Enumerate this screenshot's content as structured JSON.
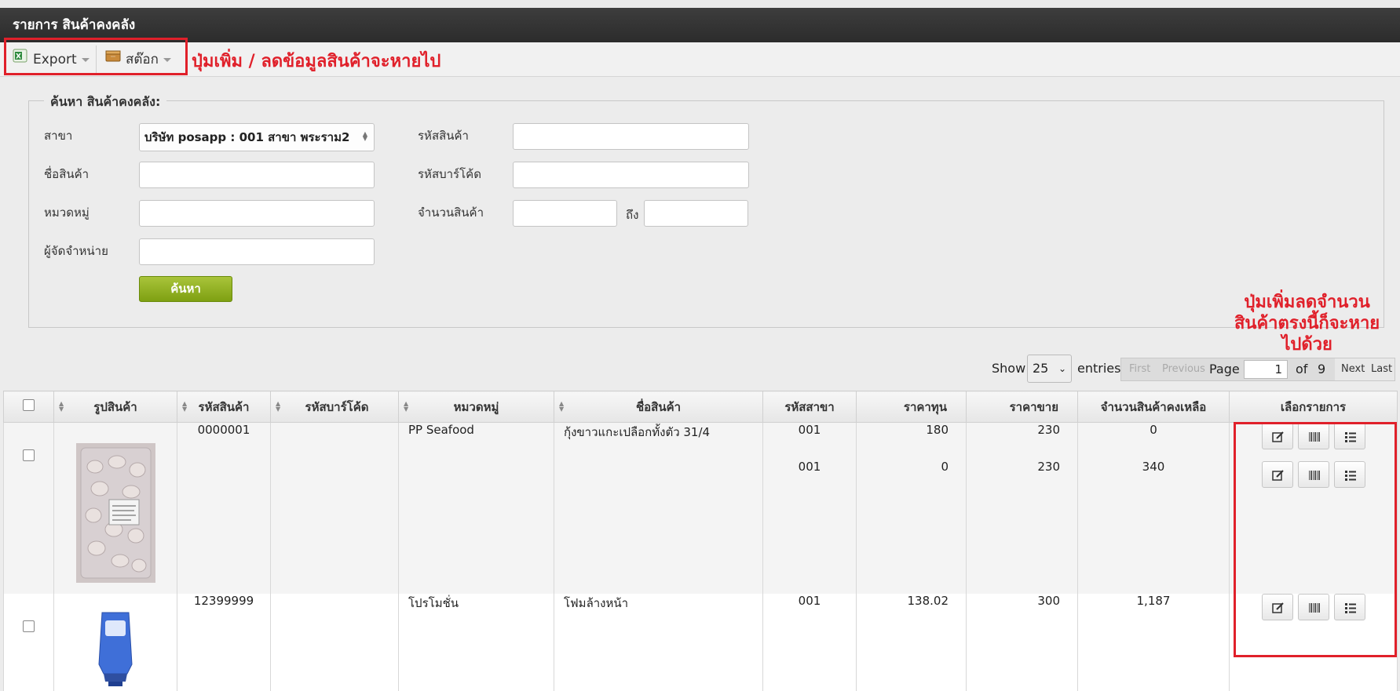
{
  "header": {
    "title": "รายการ สินค้าคงคลัง"
  },
  "toolbar": {
    "export_label": "Export",
    "stock_label": "สต๊อก"
  },
  "annotations": {
    "toolbar_note": "ปุ่มเพิ่ม / ลดข้อมูลสินค้าจะหายไป",
    "action_note_1": "ปุ่มเพิ่มลดจำนวน",
    "action_note_2": "สินค้าตรงนี้ก็จะหาย",
    "action_note_3": "ไปด้วย"
  },
  "search": {
    "legend": "ค้นหา สินค้าคงคลัง:",
    "branch_label": "สาขา",
    "branch_value": "บริษัท posapp : 001 สาขา พระราม2",
    "product_name_label": "ชื่อสินค้า",
    "category_label": "หมวดหมู่",
    "supplier_label": "ผู้จัดจำหน่าย",
    "product_code_label": "รหัสสินค้า",
    "barcode_label": "รหัสบาร์โค้ด",
    "quantity_label": "จำนวนสินค้า",
    "to_label": "ถึง",
    "search_button": "ค้นหา"
  },
  "pagination": {
    "show_label": "Show",
    "entries_value": "25",
    "entries_label": "entries",
    "first": "First",
    "previous": "Previous",
    "page_label": "Page",
    "page_value": "1",
    "of_label": "of",
    "total_pages": "9",
    "next": "Next",
    "last": "Last"
  },
  "table": {
    "columns": {
      "image": "รูปสินค้า",
      "code": "รหัสสินค้า",
      "barcode": "รหัสบาร์โค้ด",
      "category": "หมวดหมู่",
      "name": "ชื่อสินค้า",
      "branch": "รหัสสาขา",
      "cost": "ราคาทุน",
      "price": "ราคาขาย",
      "stock": "จำนวนสินค้าคงเหลือ",
      "actions": "เลือกรายการ"
    },
    "rows": [
      {
        "code": "0000001",
        "barcode": "",
        "category": "PP Seafood",
        "name": "กุ้งขาวแกะเปลือกทั้งตัว 31/4",
        "lines": [
          {
            "branch": "001",
            "cost": "180",
            "price": "230",
            "stock": "0"
          },
          {
            "branch": "001",
            "cost": "0",
            "price": "230",
            "stock": "340"
          }
        ]
      },
      {
        "code": "12399999",
        "barcode": "",
        "category": "โปรโมชั่น",
        "name": "โฟมล้างหน้า",
        "lines": [
          {
            "branch": "001",
            "cost": "138.02",
            "price": "300",
            "stock": "1,187"
          }
        ]
      }
    ]
  },
  "icons": {
    "export": "excel-icon",
    "stock": "box-icon",
    "edit": "edit-icon",
    "barcode": "barcode-icon",
    "list": "list-icon"
  },
  "colors": {
    "annotation_red": "#e0202a",
    "search_green": "#8bb01f",
    "title_bar": "#333333"
  }
}
